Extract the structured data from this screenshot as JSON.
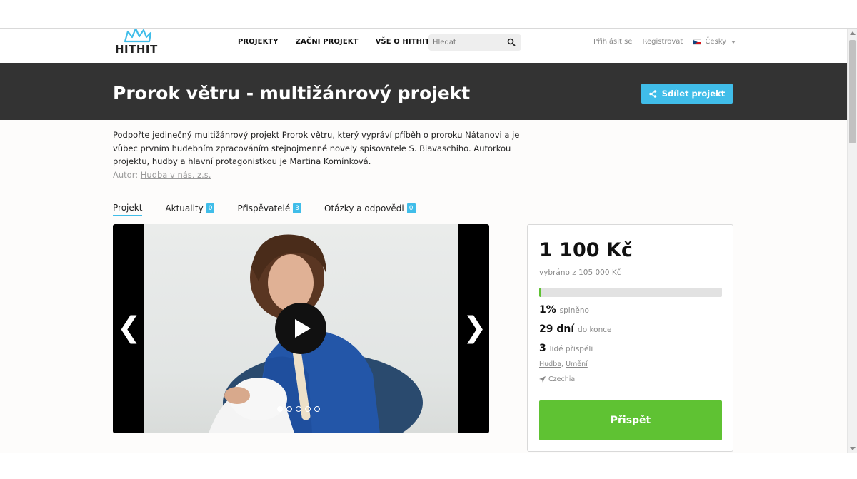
{
  "brand": {
    "logo_text": "HITHIT",
    "accent": "#40bde9",
    "green": "#5fc233"
  },
  "nav": {
    "links": [
      "PROJEKTY",
      "ZAČNI PROJEKT",
      "VŠE O HITHIT"
    ],
    "search_placeholder": "Hledat",
    "login": "Přihlásit se",
    "register": "Registrovat",
    "language": "Česky"
  },
  "hero": {
    "title": "Prorok větru - multižánrový projekt",
    "share_label": "Sdílet projekt"
  },
  "project": {
    "description": "Podpořte jedinečný multižánrový projekt Prorok větru, který vypráví příběh o proroku Nátanovi a je vůbec prvním hudebním zpracováním stejnojmenné novely spisovatele S. Biavaschiho. Autorkou projektu, hudby a hlavní protagonistkou je Martina Komínková.",
    "author_label": "Autor:",
    "author_name": "Hudba v nás, z.s."
  },
  "tabs": [
    {
      "label": "Projekt",
      "badge": ""
    },
    {
      "label": "Aktuality",
      "badge": "0"
    },
    {
      "label": "Přispěvatelé",
      "badge": "3"
    },
    {
      "label": "Otázky a odpovědi",
      "badge": "0"
    }
  ],
  "media": {
    "prev": "❮",
    "next": "❯",
    "slide_count": 5,
    "active_slide": 1
  },
  "funding": {
    "amount": "1 100 Kč",
    "goal_text": "vybráno z 105 000 Kč",
    "progress_fraction": 0.01,
    "percent_value": "1%",
    "percent_label": "splněno",
    "days_value": "29 dní",
    "days_label": "do konce",
    "backers_value": "3",
    "backers_label": "lidé přispěli",
    "category_1": "Hudba",
    "category_2": "Umění",
    "location": "Czechia",
    "cta_label": "Přispět"
  }
}
